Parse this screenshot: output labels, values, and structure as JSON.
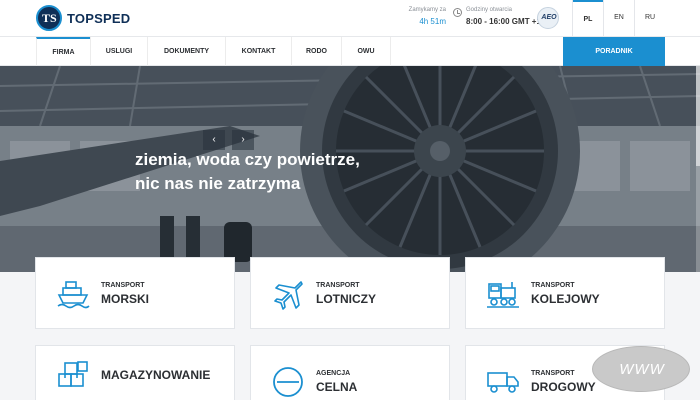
{
  "header": {
    "brand": "TOPSPED",
    "closing": {
      "label": "Zamykamy za",
      "value": "4h 51m"
    },
    "hours": {
      "label": "Godziny otwarcia",
      "value": "8:00 - 16:00 GMT +1"
    },
    "aeo_badge": "AEO",
    "languages": [
      {
        "code": "PL",
        "active": true
      },
      {
        "code": "EN",
        "active": false
      },
      {
        "code": "RU",
        "active": false
      }
    ]
  },
  "nav": {
    "items": [
      "FIRMA",
      "USLUGI",
      "DOKUMENTY",
      "KONTAKT",
      "RODO",
      "OWU"
    ],
    "active": "FIRMA",
    "cta": "PORADNIK"
  },
  "hero": {
    "line1": "ziemia, woda czy powietrze,",
    "line2": "nic nas nie zatrzyma",
    "prev": "‹",
    "next": "›"
  },
  "services": [
    {
      "kicker": "TRANSPORT",
      "title": "MORSKI",
      "icon": "ship-icon"
    },
    {
      "kicker": "TRANSPORT",
      "title": "LOTNICZY",
      "icon": "airplane-icon"
    },
    {
      "kicker": "TRANSPORT",
      "title": "KOLEJOWY",
      "icon": "train-icon"
    },
    {
      "kicker": "",
      "title": "MAGAZYNOWANIE",
      "icon": "boxes-icon"
    },
    {
      "kicker": "AGENCJA",
      "title": "CELNA",
      "icon": "customs-icon"
    },
    {
      "kicker": "TRANSPORT",
      "title": "DROGOWY",
      "icon": "truck-icon"
    }
  ],
  "watermark": "WWW",
  "colors": {
    "accent": "#1b8fd0",
    "brand_dark": "#0f2f57"
  }
}
